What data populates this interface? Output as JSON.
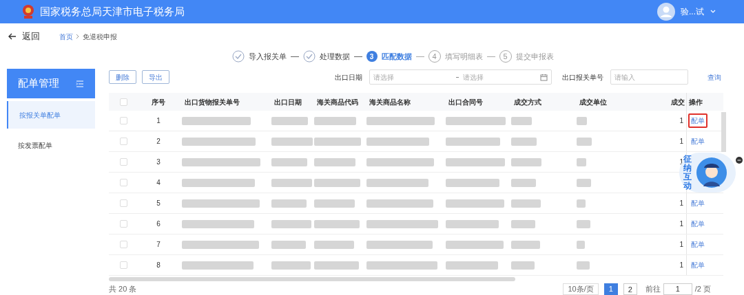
{
  "header": {
    "title": "国家税务总局天津市电子税务局",
    "user": "验...试"
  },
  "nav": {
    "back": "返回",
    "breadcrumb": [
      "首页",
      "免退税申报"
    ]
  },
  "steps": [
    {
      "label": "导入报关单",
      "completed": true,
      "current": false
    },
    {
      "label": "处理数据",
      "completed": true,
      "current": false
    },
    {
      "label": "匹配数据",
      "completed": false,
      "current": true,
      "num": "3"
    },
    {
      "label": "填写明细表",
      "completed": false,
      "current": false,
      "num": "4"
    },
    {
      "label": "提交申报表",
      "completed": false,
      "current": false,
      "num": "5"
    }
  ],
  "sidebar": {
    "title": "配单管理",
    "items": [
      {
        "label": "按报关单配单",
        "selected": true
      },
      {
        "label": "按发票配单",
        "selected": false
      }
    ]
  },
  "toolbar": {
    "buttons": [
      "删除",
      "导出"
    ],
    "date_label": "出口日期",
    "date_start": {
      "placeholder": "请选择"
    },
    "date_end": {
      "placeholder": "请选择"
    },
    "number_label": "出口报关单号",
    "number_field": {
      "placeholder": "请输入"
    },
    "query": "查询"
  },
  "table": {
    "select_all_checked": false,
    "columns": [
      "序号",
      "出口货物报关单号",
      "出口日期",
      "海关商品代码",
      "海关商品名称",
      "出口合同号",
      "成交方式",
      "成交单位",
      "成交",
      "操作"
    ],
    "rows": [
      {
        "checked": false,
        "seq": "1",
        "quantity": "1",
        "action": "配单",
        "highlighted": true
      },
      {
        "checked": false,
        "seq": "2",
        "quantity": "1",
        "action": "配单",
        "highlighted": false
      },
      {
        "checked": false,
        "seq": "3",
        "quantity": "1"
      },
      {
        "checked": false,
        "seq": "4"
      },
      {
        "checked": false,
        "seq": "5",
        "quantity": "1",
        "action": "配单",
        "highlighted": false
      },
      {
        "checked": false,
        "seq": "6",
        "quantity": "1",
        "action": "配单",
        "highlighted": false
      },
      {
        "checked": false,
        "seq": "7",
        "quantity": "1",
        "action": "配单",
        "highlighted": false
      },
      {
        "checked": false,
        "seq": "8",
        "quantity": "1",
        "action": "配单",
        "highlighted": false
      }
    ]
  },
  "floating_widget": {
    "label": "征纳互动"
  },
  "pagination": {
    "total": "共 20 条",
    "page_size": "10条/页",
    "pages": [
      {
        "label": "1",
        "selected": true
      },
      {
        "label": "2",
        "selected": false
      }
    ],
    "goto_label": "前往",
    "goto_value": "1",
    "page_count": "/2 页"
  }
}
